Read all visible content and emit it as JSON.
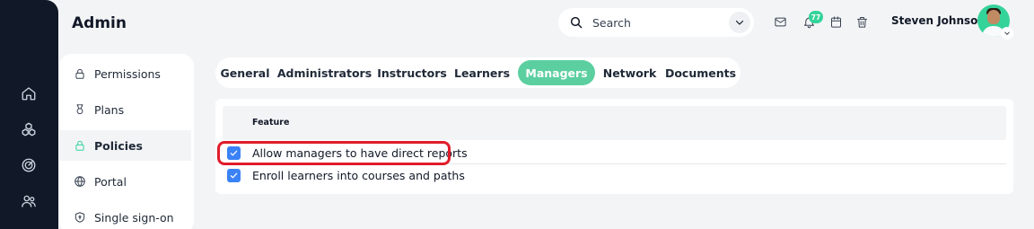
{
  "app": {
    "title": "Admin"
  },
  "search": {
    "placeholder": "Search"
  },
  "header": {
    "notifications_count": "77",
    "user_name": "Steven Johnson"
  },
  "rail": {
    "icons": [
      "home-icon",
      "courses-icon",
      "target-icon",
      "users-icon"
    ]
  },
  "subnav": {
    "items": [
      {
        "label": "Permissions",
        "icon": "lock-icon",
        "active": false
      },
      {
        "label": "Plans",
        "icon": "medal-icon",
        "active": false
      },
      {
        "label": "Policies",
        "icon": "lock-icon",
        "active": true
      },
      {
        "label": "Portal",
        "icon": "globe-icon",
        "active": false
      },
      {
        "label": "Single sign-on",
        "icon": "shield-icon",
        "active": false
      }
    ]
  },
  "tabs": {
    "items": [
      {
        "label": "General"
      },
      {
        "label": "Administrators"
      },
      {
        "label": "Instructors"
      },
      {
        "label": "Learners"
      },
      {
        "label": "Managers",
        "active": true
      },
      {
        "label": "Network"
      },
      {
        "label": "Documents"
      }
    ]
  },
  "table": {
    "header": "Feature",
    "rows": [
      {
        "label": "Allow managers to have direct reports",
        "checked": true,
        "highlighted": true
      },
      {
        "label": "Enroll learners into courses and paths",
        "checked": true
      }
    ]
  },
  "colors": {
    "accent": "#5ccfa0",
    "checkbox": "#3b82f6",
    "highlight": "#e11d2a",
    "rail": "#111827"
  }
}
